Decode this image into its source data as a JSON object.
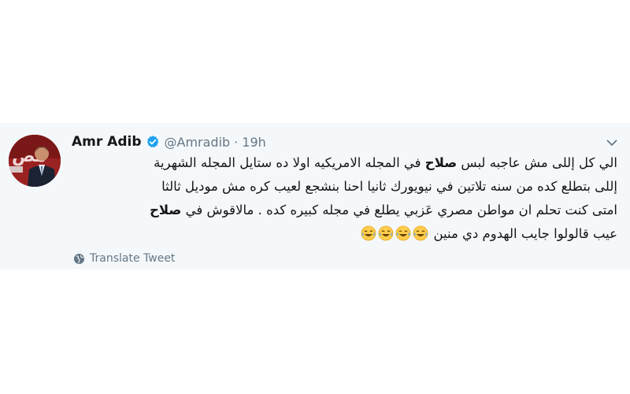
{
  "tweet": {
    "author": {
      "name": "Amr Adib",
      "handle": "@Amradib",
      "verified": true,
      "avatar_icon": "profile-photo"
    },
    "separator": "·",
    "time": "19h",
    "lines": {
      "l1_pre": "الي كل إللى مش عاجبه لبس ",
      "l1_bold": "صلاح",
      "l1_post": " في المجله الامريكيه اولا ده ستايل المجله الشهرية",
      "l2": "إللى بتطلع كده من سنه تلاتين في نيويورك ثانيا احنا بنشجع لعيب كره مش موديل ثالثا",
      "l3_pre": "امتى كنت تحلم ان مواطن مصري عَزبي يطلع في مجله كبيره كده . مالاقوش في ",
      "l3_bold": "صلاح",
      "l4": "عيب قالولوا جايب الهدوم دي منين"
    },
    "emojis": [
      "face-with-tears-of-joy",
      "face-with-tears-of-joy",
      "face-with-tears-of-joy",
      "face-with-tears-of-joy"
    ],
    "translate_label": "Translate Tweet",
    "colors": {
      "background": "#f5f8fa",
      "text": "#14171a",
      "secondary": "#657786",
      "verified": "#1da1f2"
    }
  }
}
